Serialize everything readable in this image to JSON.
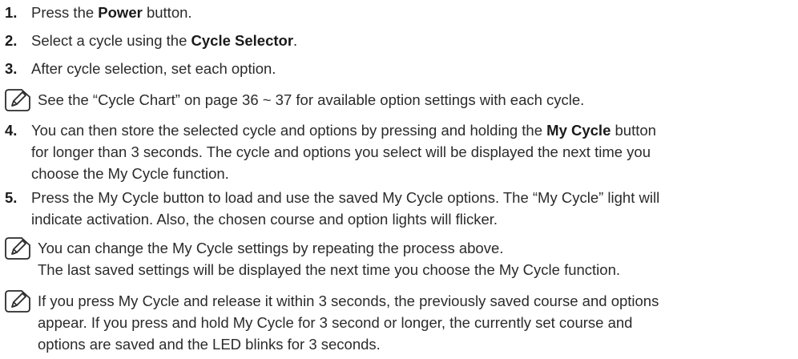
{
  "steps": [
    {
      "number": "1.",
      "before": "Press the ",
      "bold": "Power",
      "after": " button."
    },
    {
      "number": "2.",
      "before": "Select a cycle using the ",
      "bold": "Cycle Selector",
      "after": "."
    },
    {
      "number": "3.",
      "text": "After cycle selection, set each option."
    },
    {
      "number": "4.",
      "line1_before": "You can then store the selected cycle and options by pressing and holding the ",
      "line1_bold": "My Cycle",
      "line1_after": " button",
      "line2": "for longer than 3 seconds. The cycle and options you select will be displayed the next time you",
      "line3": "choose the My Cycle function."
    },
    {
      "number": "5.",
      "line1": "Press the My Cycle button to load and use the saved My Cycle options. The “My Cycle” light will",
      "line2": "indicate activation. Also, the chosen course and option lights will flicker."
    }
  ],
  "notes": [
    {
      "line1": "See the “Cycle Chart” on page 36 ~ 37 for available option settings with each cycle."
    },
    {
      "line1": "You can change the My Cycle settings by repeating the process above.",
      "line2": "The last saved settings will be displayed the next time you choose the My Cycle function."
    },
    {
      "line1": "If you press My Cycle and release it within 3 seconds, the previously saved course and options",
      "line2": "appear. If you press and hold My Cycle for 3 second or longer, the currently set course and",
      "line3": "options are saved and the LED blinks for 3 seconds."
    }
  ],
  "icon": "note-pencil-icon"
}
